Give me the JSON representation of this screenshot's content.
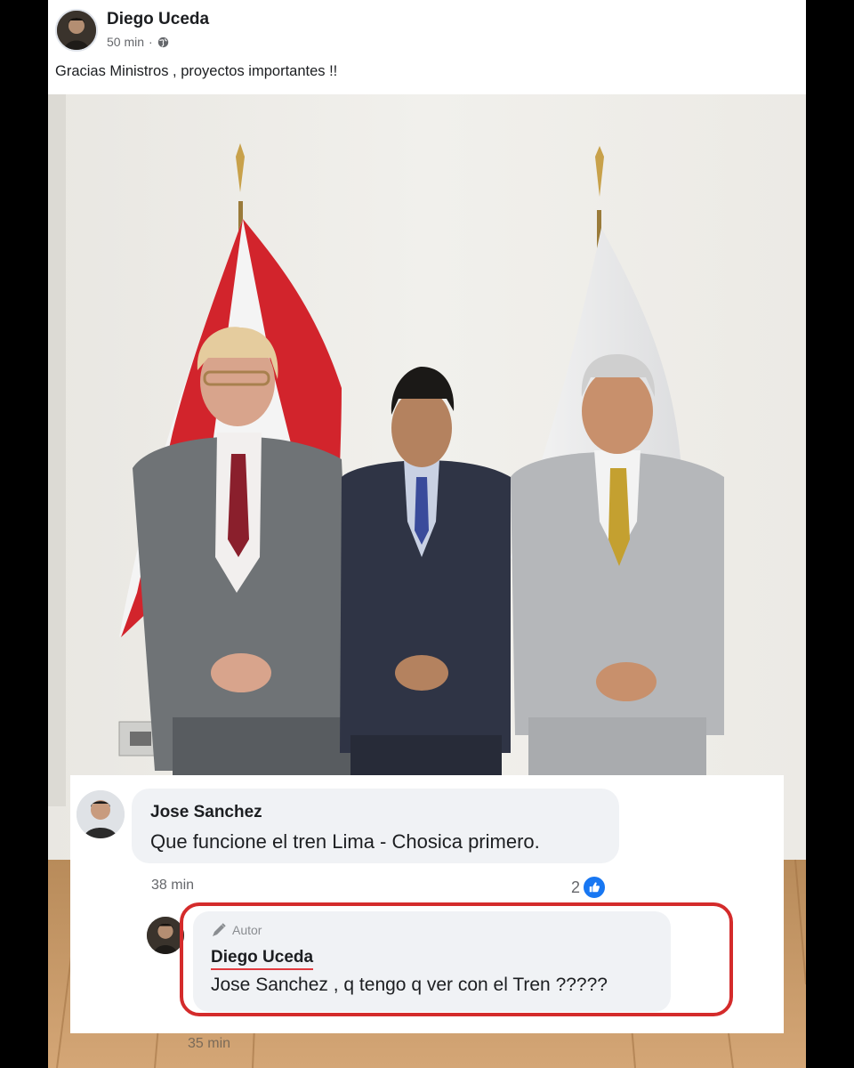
{
  "post": {
    "author": "Diego Uceda",
    "time": "50 min",
    "separator": "·",
    "privacy_icon": "globe-icon",
    "text": "Gracias Ministros , proyectos importantes !!"
  },
  "photo": {
    "description_icon": "photo-of-three-men-with-flags"
  },
  "comments": [
    {
      "author": "Jose Sanchez",
      "text": "Que funcione el tren Lima - Chosica primero.",
      "time": "38 min",
      "likes": "2",
      "like_icon": "thumbs-up-icon"
    }
  ],
  "reply": {
    "badge": "Autor",
    "badge_icon": "pen-icon",
    "author": "Diego Uceda",
    "text": "Jose Sanchez , q tengo q ver con el Tren ?????",
    "time": "35 min"
  },
  "colors": {
    "highlight": "#d42b2b",
    "like_blue": "#1877f2",
    "bubble": "#f0f2f5"
  }
}
